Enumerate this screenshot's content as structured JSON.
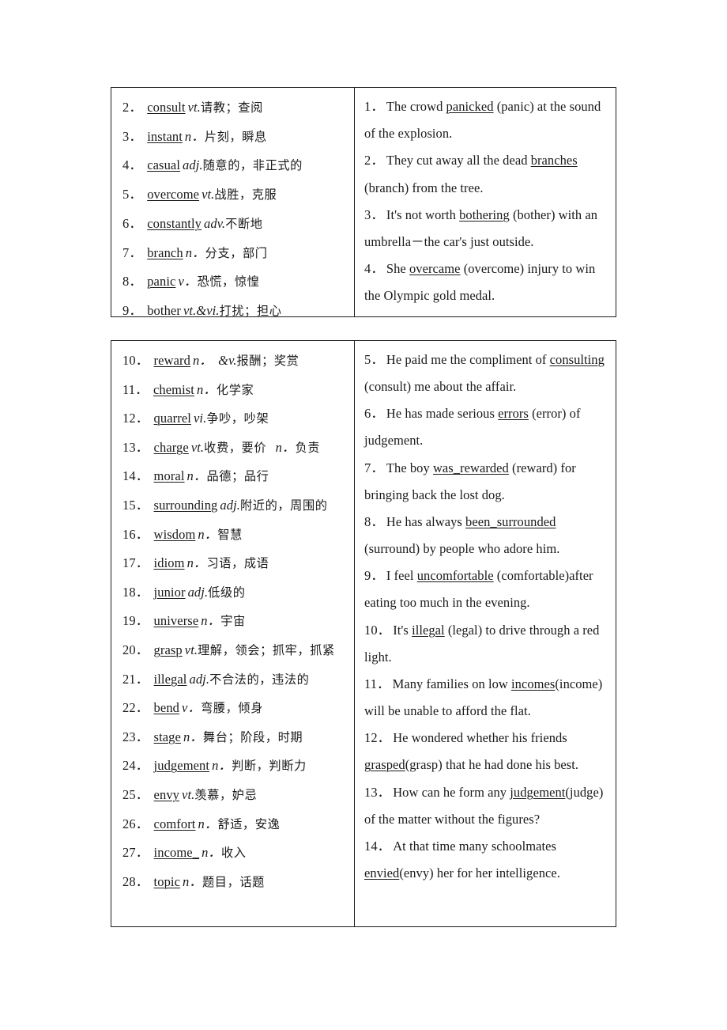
{
  "document": {
    "type": "english-vocabulary-worksheet",
    "background_color": "#ffffff",
    "text_color": "#1a1a1a",
    "border_color": "#1d1d1d"
  },
  "tables": [
    {
      "id": "table-one",
      "vocabulary": [
        {
          "num": "2",
          "word": "consult",
          "pos": "vt.",
          "cn": "请教；查阅"
        },
        {
          "num": "3",
          "word": "instant",
          "pos": "n．",
          "cn": "片刻，瞬息"
        },
        {
          "num": "4",
          "word": "casual",
          "pos": "adj.",
          "cn": "随意的，非正式的"
        },
        {
          "num": "5",
          "word": "overcome",
          "pos": "vt.",
          "cn": "战胜，克服"
        },
        {
          "num": "6",
          "word": "constantly",
          "pos": "adv.",
          "cn": "不断地"
        },
        {
          "num": "7",
          "word": "branch",
          "pos": "n．",
          "cn": "分支，部门"
        },
        {
          "num": "8",
          "word": "panic",
          "pos": "v．",
          "cn": "恐慌，惊惶"
        },
        {
          "num": "9",
          "word": "bother",
          "pos": "vt.&vi.",
          "cn": "打扰；担心"
        }
      ],
      "sentences": [
        {
          "num": "1",
          "before": "The crowd ",
          "answer": "panicked",
          "after": " (panic) at the sound of the explosion."
        },
        {
          "num": "2",
          "before": "They cut away all the dead ",
          "answer": "branches",
          "after": " (branch) from the tree."
        },
        {
          "num": "3",
          "before": "It's not worth ",
          "answer": "bothering",
          "after": " (bother) with an umbrella－the car's just outside."
        },
        {
          "num": "4",
          "before": "She ",
          "answer": "overcame",
          "after": " (overcome) injury to win the Olympic gold medal."
        }
      ]
    },
    {
      "id": "table-two",
      "vocabulary": [
        {
          "num": "10",
          "word": "reward",
          "pos": "n．",
          "pos2": "&v.",
          "cn": "报酬；奖赏"
        },
        {
          "num": "11",
          "word": "chemist",
          "pos": "n．",
          "cn": "化学家"
        },
        {
          "num": "12",
          "word": "quarrel",
          "pos": "vi.",
          "cn": "争吵，吵架"
        },
        {
          "num": "13",
          "word": "charge",
          "pos": "vt.",
          "cn": "收费，要价",
          "pos3": "n．",
          "cn2": "负责"
        },
        {
          "num": "14",
          "word": "moral",
          "pos": "n．",
          "cn": "品德；品行"
        },
        {
          "num": "15",
          "word": "surrounding",
          "pos": "adj.",
          "cn": "附近的，周围的"
        },
        {
          "num": "16",
          "word": "wisdom",
          "pos": "n．",
          "cn": "智慧"
        },
        {
          "num": "17",
          "word": "idiom",
          "pos": "n．",
          "cn": "习语，成语"
        },
        {
          "num": "18",
          "word": "junior",
          "pos": "adj.",
          "cn": "低级的"
        },
        {
          "num": "19",
          "word": "universe",
          "pos": "n．",
          "cn": "宇宙"
        },
        {
          "num": "20",
          "word": "grasp",
          "pos": "vt.",
          "cn": "理解，领会；抓牢，抓紧",
          "wraps": true
        },
        {
          "num": "21",
          "word": "illegal",
          "pos": "adj.",
          "cn": "不合法的，违法的"
        },
        {
          "num": "22",
          "word": "bend",
          "pos": "v．",
          "cn": "弯腰，倾身"
        },
        {
          "num": "23",
          "word": "stage",
          "pos": "n．",
          "cn": "舞台；阶段，时期"
        },
        {
          "num": "24",
          "word": "judgement",
          "pos": "n．",
          "cn": "判断，判断力"
        },
        {
          "num": "25",
          "word": "envy",
          "pos": "vt.",
          "cn": "羡慕，妒忌"
        },
        {
          "num": "26",
          "word": "comfort",
          "pos": "n．",
          "cn": "舒适，安逸"
        },
        {
          "num": "27",
          "word": "income_",
          "pos": "n．",
          "cn": "收入"
        },
        {
          "num": "28",
          "word": "topic",
          "pos": "n．",
          "cn": "题目，话题"
        }
      ],
      "sentences": [
        {
          "num": "5",
          "before": "He paid me the compliment of ",
          "answer": "consulting",
          "after": " (consult) me about the affair."
        },
        {
          "num": "6",
          "before": "He has made serious ",
          "answer": "errors",
          "after": " (error) of judgement."
        },
        {
          "num": "7",
          "before": "The boy ",
          "answer": "was_rewarded",
          "after": " (reward) for bringing back the lost dog."
        },
        {
          "num": "8",
          "before": "He has always ",
          "answer": "been_surrounded",
          "after": " (surround) by people who adore him."
        },
        {
          "num": "9",
          "before": "I feel ",
          "answer": "uncomfortable",
          "after": " (comfortable)after eating too much in the evening."
        },
        {
          "num": "10",
          "before": "It's ",
          "answer": "illegal",
          "after": " (legal) to drive through a red light."
        },
        {
          "num": "11",
          "before": "Many families on low ",
          "answer": "incomes",
          "after": "(income) will be unable to afford the flat."
        },
        {
          "num": "12",
          "before": "He wondered whether his friends ",
          "answer": "grasped",
          "after": "(grasp) that he had done his best."
        },
        {
          "num": "13",
          "before": "How can he form any ",
          "answer": "judgement",
          "after": "(judge) of the matter without the figures?"
        },
        {
          "num": "14",
          "before": "At that time many schoolmates ",
          "answer": "envied",
          "after": "(envy) her for her intelligence."
        }
      ]
    }
  ]
}
